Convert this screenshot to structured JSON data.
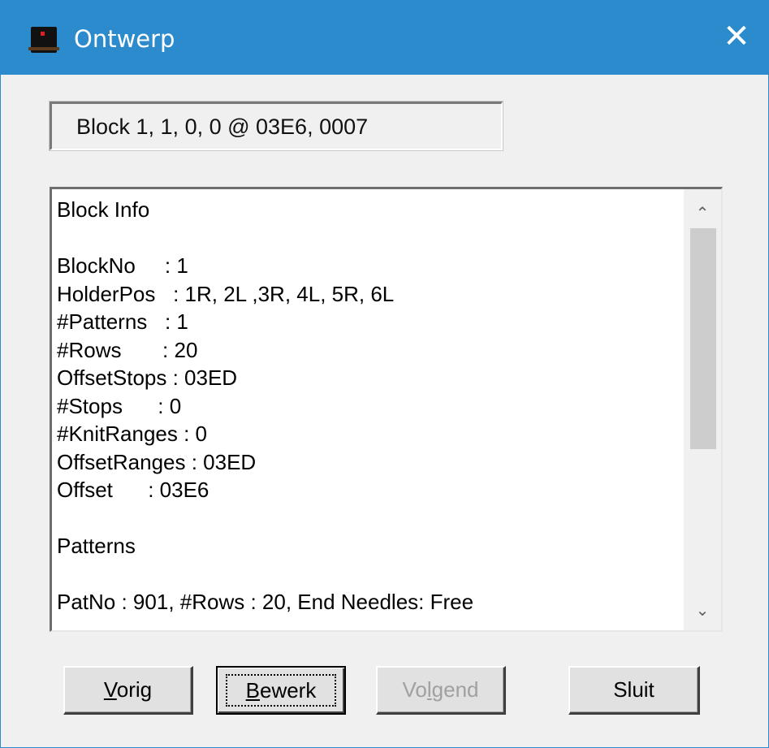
{
  "window": {
    "title": "Ontwerp",
    "close_symbol": "✕",
    "icon": "app-icon"
  },
  "address": {
    "value": "Block 1,  1,  0, 0 @ 03E6, 0007"
  },
  "info": {
    "lines": [
      "Block Info",
      "",
      "BlockNo     : 1",
      "HolderPos   : 1R, 2L ,3R, 4L, 5R, 6L",
      "#Patterns   : 1",
      "#Rows       : 20",
      "OffsetStops : 03ED",
      "#Stops      : 0",
      "#KnitRanges : 0",
      "OffsetRanges : 03ED",
      "Offset      : 03E6",
      "",
      "Patterns",
      "",
      "PatNo : 901, #Rows : 20, End Needles: Free"
    ],
    "scroll_up_symbol": "⌃",
    "scroll_down_symbol": "⌄"
  },
  "buttons": {
    "vorig": {
      "mnemonic": "V",
      "rest": "orig",
      "enabled": true
    },
    "bewerk": {
      "mnemonic": "B",
      "rest": "ewerk",
      "enabled": true,
      "focused": true
    },
    "volgend": {
      "pre": "Vo",
      "mnemonic": "l",
      "rest": "gend",
      "enabled": false
    },
    "sluit": {
      "label": "Sluit",
      "enabled": true
    }
  },
  "colors": {
    "titlebar": "#2b8bcc",
    "window_bg": "#f0f0f0",
    "disabled_text": "#a0a0a0"
  }
}
